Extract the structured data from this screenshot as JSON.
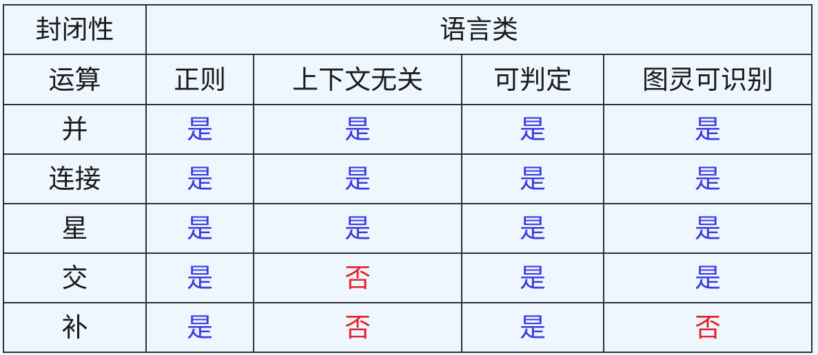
{
  "header": {
    "corner": "封闭性",
    "group": "语言类",
    "ops_label": "运算",
    "columns": [
      "正则",
      "上下文无关",
      "可判定",
      "图灵可识别"
    ]
  },
  "rows": [
    {
      "op": "并",
      "values": [
        "是",
        "是",
        "是",
        "是"
      ]
    },
    {
      "op": "连接",
      "values": [
        "是",
        "是",
        "是",
        "是"
      ]
    },
    {
      "op": "星",
      "values": [
        "是",
        "是",
        "是",
        "是"
      ]
    },
    {
      "op": "交",
      "values": [
        "是",
        "否",
        "是",
        "是"
      ]
    },
    {
      "op": "补",
      "values": [
        "是",
        "否",
        "是",
        "否"
      ]
    }
  ],
  "colors": {
    "yes": "#3a3ae0",
    "no": "#e8222a",
    "background": "#eef6fe",
    "border": "#2e2e2e"
  }
}
